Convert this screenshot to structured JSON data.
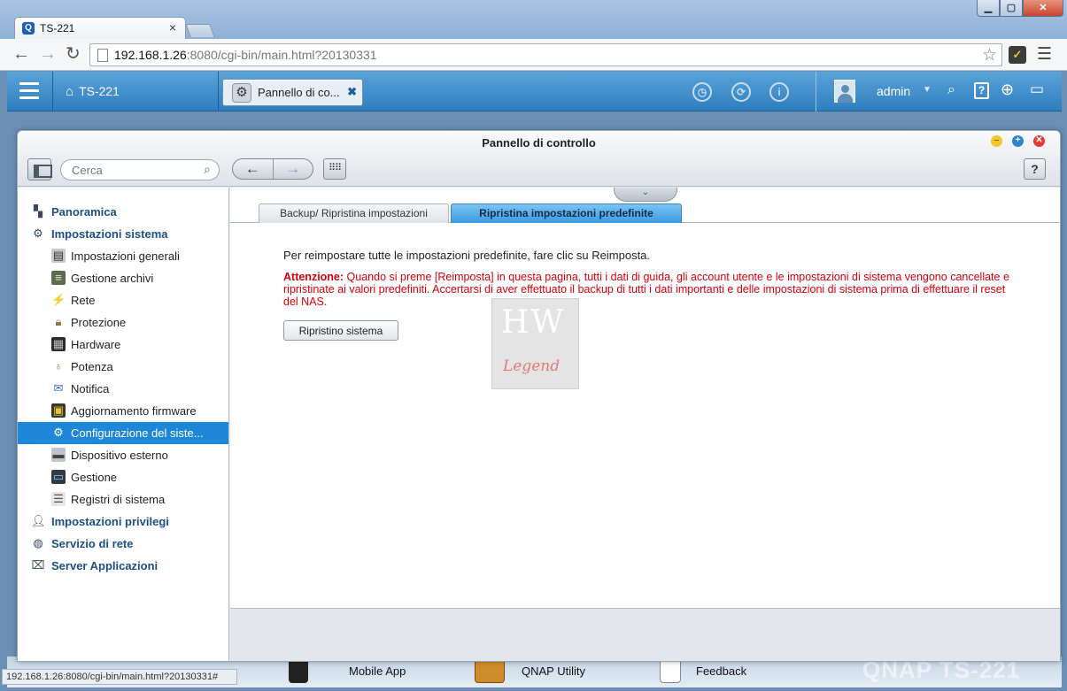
{
  "browser": {
    "tab_title": "TS-221",
    "tab_close": "×",
    "url_host": "192.168.1.26",
    "url_rest": ":8080/cgi-bin/main.html?20130331",
    "status_url": "192.168.1.26:8080/cgi-bin/main.html?20130331#"
  },
  "qnap_bar": {
    "home_label": "TS-221",
    "app_tab_title": "Pannello di co...",
    "app_tab_close": "✖",
    "username": "admin",
    "help_label": "?"
  },
  "window": {
    "title": "Pannello di controllo",
    "search_placeholder": "Cerca",
    "help_label": "?"
  },
  "sidebar": {
    "categories": [
      {
        "label": "Panoramica",
        "icon": "overview-icon"
      },
      {
        "label": "Impostazioni sistema",
        "icon": "gear-icon"
      },
      {
        "label": "Impostazioni privilegi",
        "icon": "user-icon"
      },
      {
        "label": "Servizio di rete",
        "icon": "globe-icon"
      },
      {
        "label": "Server Applicazioni",
        "icon": "inbox-icon"
      }
    ],
    "items": [
      {
        "label": "Impostazioni generali",
        "icon": "settings-doc-icon"
      },
      {
        "label": "Gestione archivi",
        "icon": "storage-icon"
      },
      {
        "label": "Rete",
        "icon": "network-icon"
      },
      {
        "label": "Protezione",
        "icon": "lock-icon"
      },
      {
        "label": "Hardware",
        "icon": "hardware-icon"
      },
      {
        "label": "Potenza",
        "icon": "bulb-icon"
      },
      {
        "label": "Notifica",
        "icon": "notification-icon"
      },
      {
        "label": "Aggiornamento firmware",
        "icon": "firmware-icon"
      },
      {
        "label": "Configurazione del siste...",
        "icon": "system-config-icon"
      },
      {
        "label": "Dispositivo esterno",
        "icon": "external-device-icon"
      },
      {
        "label": "Gestione",
        "icon": "monitor-icon"
      },
      {
        "label": "Registri di sistema",
        "icon": "log-icon"
      }
    ]
  },
  "content": {
    "tabs": [
      {
        "label": "Backup/ Ripristina impostazioni",
        "active": false
      },
      {
        "label": "Ripristina impostazioni predefinite",
        "active": true
      }
    ],
    "description": "Per reimpostare tutte le impostazioni predefinite, fare clic su Reimposta.",
    "warning_label": "Attenzione:",
    "warning_text": " Quando si preme [Reimposta] in questa pagina, tutti i dati di guida, gli account utente e le impostazioni di sistema vengono cancellate e ripristinate ai valori predefiniti. Accertarsi di aver effettuato il backup di tutti i dati importanti e delle impostazioni di sistema prima di effettuare il reset del NAS.",
    "reset_button": "Ripristino sistema",
    "watermark_top": "HW",
    "watermark_bottom": "Legend"
  },
  "dock": {
    "items": [
      "Mobile App",
      "QNAP Utility",
      "Feedback"
    ],
    "brand": "QNAP TS-221"
  },
  "colors": {
    "qnap_bar": "#2f7ec0",
    "active_item": "#1f87d8",
    "warning": "#d8000c",
    "category_text": "#1b4f86"
  }
}
